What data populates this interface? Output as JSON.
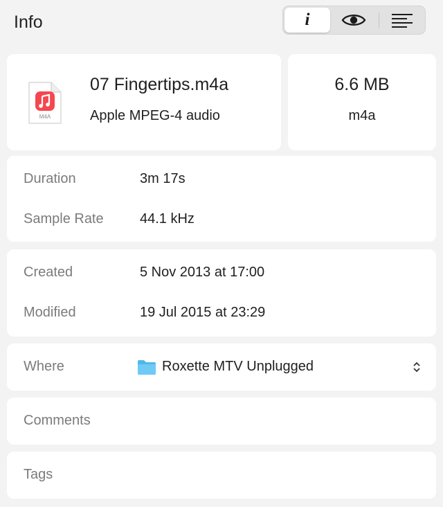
{
  "header": {
    "title": "Info",
    "segments": [
      {
        "name": "info",
        "glyph": "i",
        "active": true
      },
      {
        "name": "preview",
        "icon": "eye-icon",
        "active": false
      },
      {
        "name": "details",
        "icon": "align-left-icon",
        "active": false
      }
    ]
  },
  "file": {
    "name": "07 Fingertips.m4a",
    "kind": "Apple MPEG-4 audio",
    "icon_badge": "M4A",
    "size": "6.6 MB",
    "extension": "m4a"
  },
  "media": {
    "duration_label": "Duration",
    "duration_value": "3m 17s",
    "sample_rate_label": "Sample Rate",
    "sample_rate_value": "44.1 kHz"
  },
  "dates": {
    "created_label": "Created",
    "created_value": "5 Nov 2013 at 17:00",
    "modified_label": "Modified",
    "modified_value": "19 Jul 2015 at 23:29"
  },
  "where": {
    "label": "Where",
    "value": "Roxette MTV Unplugged"
  },
  "comments": {
    "label": "Comments"
  },
  "tags": {
    "label": "Tags"
  },
  "colors": {
    "accent_red": "#f5474f",
    "folder_blue": "#5ac8fa"
  }
}
